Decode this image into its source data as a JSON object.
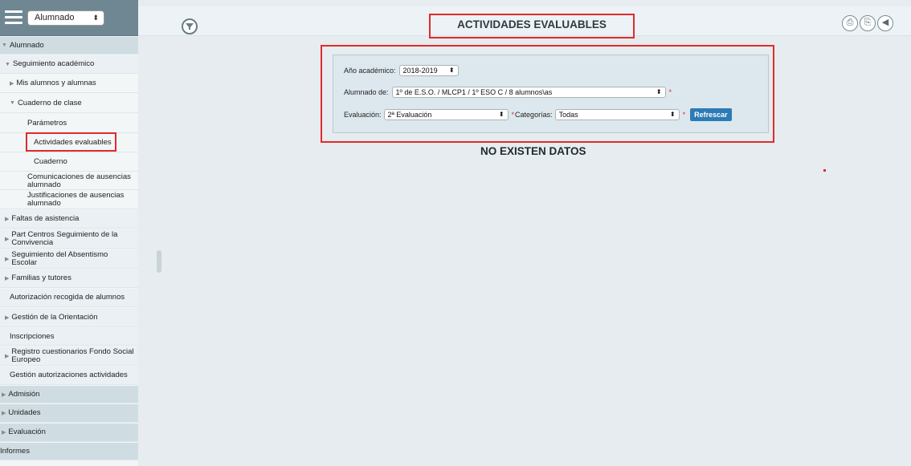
{
  "sidebar": {
    "profile_select": "Alumnado",
    "items": [
      {
        "label": "Alumnado",
        "marker": "▼"
      },
      {
        "label": "Seguimiento académico",
        "marker": "▼"
      },
      {
        "label": "Mis alumnos y alumnas",
        "marker": "▶"
      },
      {
        "label": "Cuaderno de clase",
        "marker": "▼"
      },
      {
        "label": "Parámetros",
        "marker": ""
      },
      {
        "label": "Actividades evaluables",
        "marker": ""
      },
      {
        "label": "Cuaderno",
        "marker": ""
      },
      {
        "label": "Comunicaciones de ausencias alumnado",
        "marker": ""
      },
      {
        "label": "Justificaciones de ausencias alumnado",
        "marker": ""
      },
      {
        "label": "Faltas de asistencia",
        "marker": "▶"
      },
      {
        "label": "Part Centros Seguimiento de la Convivencia",
        "marker": "▶"
      },
      {
        "label": "Seguimiento del Absentismo Escolar",
        "marker": "▶"
      },
      {
        "label": "Familias y tutores",
        "marker": "▶"
      },
      {
        "label": "Autorización recogida de alumnos",
        "marker": ""
      },
      {
        "label": "Gestión de la Orientación",
        "marker": "▶"
      },
      {
        "label": "Inscripciones",
        "marker": ""
      },
      {
        "label": "Registro cuestionarios Fondo Social Europeo",
        "marker": "▶"
      },
      {
        "label": "Gestión autorizaciones actividades",
        "marker": ""
      },
      {
        "label": "Admisión",
        "marker": "▶"
      },
      {
        "label": "Unidades",
        "marker": "▶"
      },
      {
        "label": "Evaluación",
        "marker": "▶"
      },
      {
        "label": "Informes",
        "marker": ""
      }
    ]
  },
  "header": {
    "title": "ACTIVIDADES EVALUABLES",
    "icons": [
      "filter-icon",
      "pdf-icon",
      "print-icon",
      "back-icon"
    ]
  },
  "filters": {
    "academic_year_label": "Año académico:",
    "academic_year_value": "2018-2019",
    "students_label": "Alumnado de:",
    "students_value": "1º de E.S.O. / MLCP1 / 1º ESO C / 8 alumnos\\as",
    "evaluation_label": "Evaluación:",
    "evaluation_value": "2ª Evaluación",
    "categories_label": "Categorías:",
    "categories_value": "Todas",
    "required_mark": "*",
    "refresh_label": "Refrescar"
  },
  "main": {
    "empty_message": "NO EXISTEN DATOS"
  },
  "colors": {
    "sidebar_header": "#6f8792",
    "highlight": "#e02b2b",
    "button": "#2c7bb6",
    "panel": "#dde8ee"
  }
}
